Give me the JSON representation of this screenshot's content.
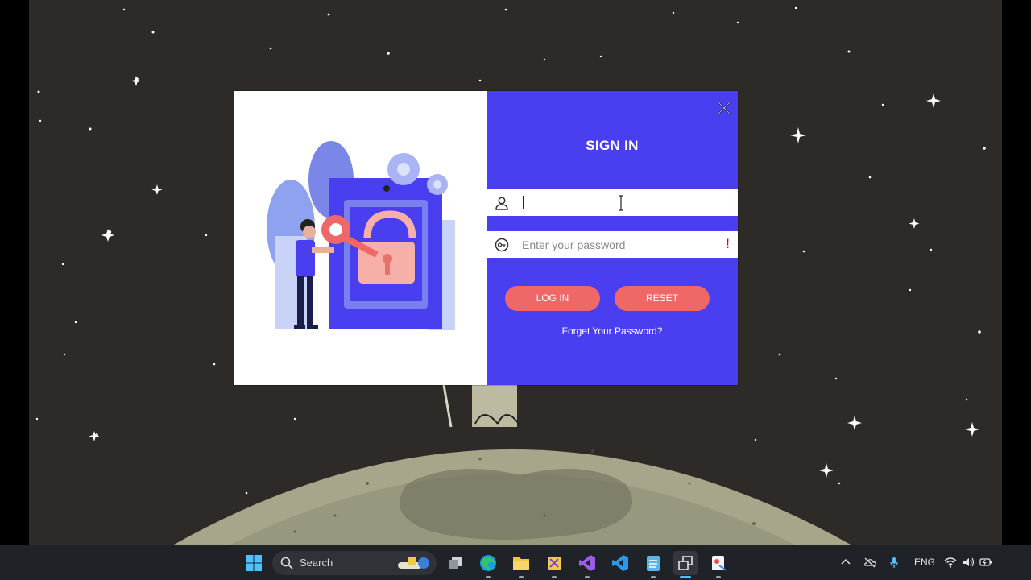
{
  "login": {
    "title": "SIGN IN",
    "username_value": "",
    "username_placeholder": "",
    "password_placeholder": "Enter your password",
    "password_warning": "!",
    "login_label": "LOG IN",
    "reset_label": "RESET",
    "forgot_label": "Forget Your Password?"
  },
  "colors": {
    "form_panel": "#4a3ff0",
    "button": "#ef6766",
    "desktop": "#2e2a27"
  },
  "taskbar": {
    "search_label": "Search",
    "language": "ENG",
    "apps": [
      "windows-start-icon",
      "search-icon",
      "task-view-icon",
      "edge-icon",
      "file-explorer-icon",
      "snipping-tool-icon",
      "visual-studio-icon",
      "vscode-icon",
      "notepad-icon",
      "active-window-icon",
      "paint-icon"
    ],
    "tray": [
      "chevron-up-icon",
      "onedrive-icon",
      "microphone-icon",
      "wifi-icon",
      "speaker-icon",
      "battery-icon"
    ]
  }
}
